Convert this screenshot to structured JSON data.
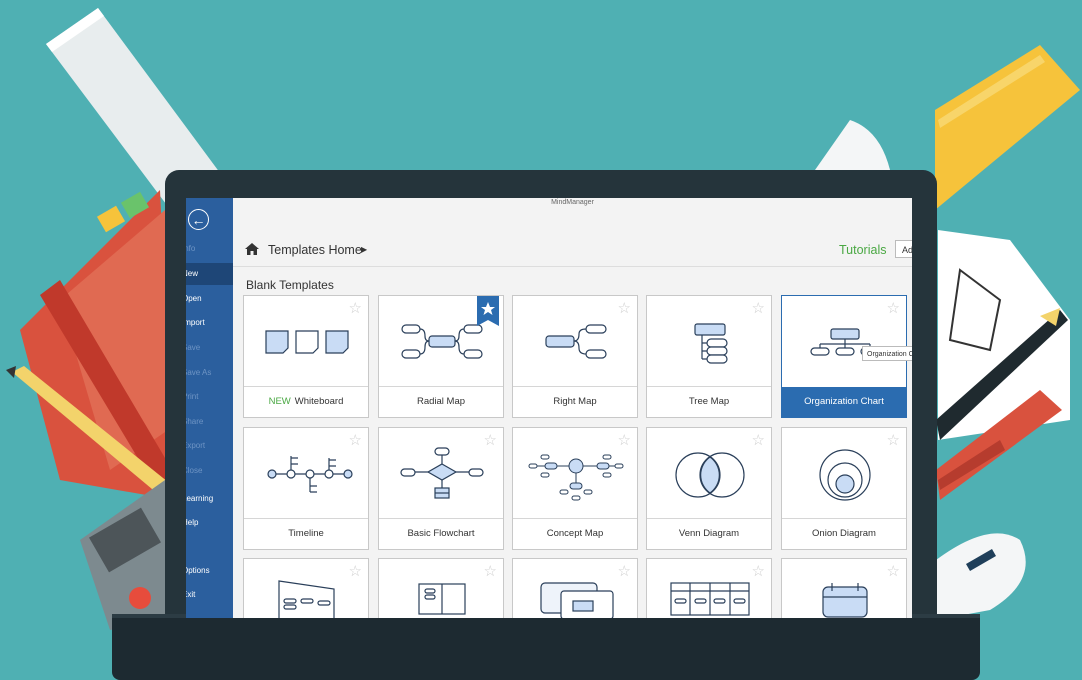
{
  "window": {
    "title": "MindManager"
  },
  "sidebar": {
    "items": [
      {
        "label": "Info",
        "state": "dim"
      },
      {
        "label": "New",
        "state": "active"
      },
      {
        "label": "Open",
        "state": "normal"
      },
      {
        "label": "Import",
        "state": "normal"
      },
      {
        "label": "Save",
        "state": "dim"
      },
      {
        "label": "Save As",
        "state": "dim"
      },
      {
        "label": "Print",
        "state": "dim"
      },
      {
        "label": "Share",
        "state": "dim"
      },
      {
        "label": "Export",
        "state": "dim"
      },
      {
        "label": "Close",
        "state": "dim"
      },
      {
        "label": "Learning",
        "state": "normal"
      },
      {
        "label": "Help",
        "state": "normal"
      },
      {
        "label": "Options",
        "state": "normal"
      },
      {
        "label": "Exit",
        "state": "normal"
      }
    ]
  },
  "header": {
    "breadcrumb": "Templates Home",
    "tutorials": "Tutorials",
    "add_button": "Ad"
  },
  "section": {
    "title": "Blank Templates"
  },
  "templates": [
    {
      "label": "Whiteboard",
      "badge": "NEW",
      "icon": "whiteboard-thumbnail"
    },
    {
      "label": "Radial Map",
      "icon": "radial-map-thumbnail",
      "favorite": true
    },
    {
      "label": "Right Map",
      "icon": "right-map-thumbnail"
    },
    {
      "label": "Tree Map",
      "icon": "tree-map-thumbnail"
    },
    {
      "label": "Organization Chart",
      "icon": "org-chart-thumbnail",
      "selected": true
    },
    {
      "label": "Timeline",
      "icon": "timeline-thumbnail"
    },
    {
      "label": "Basic Flowchart",
      "icon": "flowchart-thumbnail"
    },
    {
      "label": "Concept Map",
      "icon": "concept-map-thumbnail"
    },
    {
      "label": "Venn Diagram",
      "icon": "venn-thumbnail"
    },
    {
      "label": "Onion Diagram",
      "icon": "onion-thumbnail"
    }
  ],
  "tooltip": {
    "text": "Organization Chart"
  },
  "colors": {
    "accent": "#2b6cb0",
    "sidebar": "#2b5f9e",
    "green": "#4aa843",
    "background": "#4fb0b3",
    "node_fill": "#c9dcf5",
    "node_stroke": "#2a3f5a"
  }
}
